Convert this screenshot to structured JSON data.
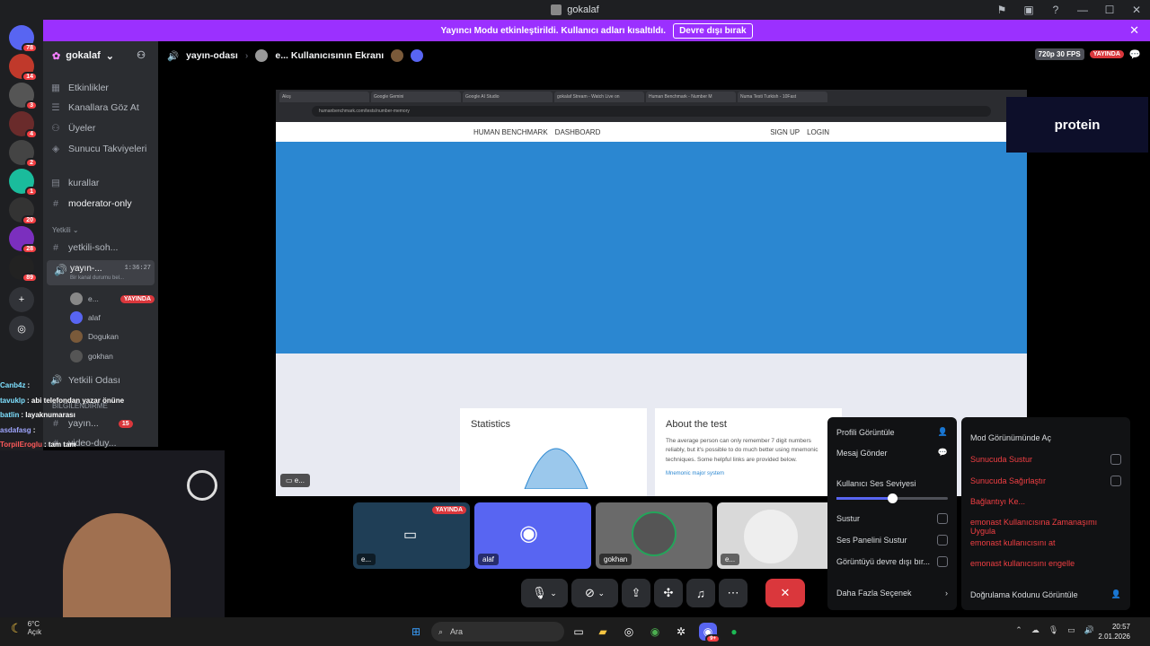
{
  "window": {
    "title": "gokalaf"
  },
  "notice": {
    "text": "Yayıncı Modu etkinleştirildi. Kullanıcı adları kısaltıldı.",
    "button": "Devre dışı bırak"
  },
  "servers": [
    {
      "badge": "78",
      "color": "#5865f2",
      "icon": "discord-icon"
    },
    {
      "badge": "14",
      "color": "#c0392b",
      "icon": "server-icon"
    },
    {
      "badge": "3",
      "color": "#555",
      "icon": "server-icon"
    },
    {
      "badge": "4",
      "color": "#6a2b2b",
      "icon": "server-icon"
    },
    {
      "badge": "2",
      "color": "#444",
      "icon": "eye-icon"
    },
    {
      "badge": "1",
      "color": "#1abc9c",
      "icon": "smile-icon"
    },
    {
      "badge": "20",
      "color": "#333",
      "icon": "server-icon"
    },
    {
      "badge": "28",
      "color": "#7b2fbe",
      "icon": "wifi-icon"
    },
    {
      "badge": "89",
      "color": "#222",
      "icon": "server-icon"
    }
  ],
  "server_header": {
    "name": "gokalaf"
  },
  "nav": [
    {
      "icon": "calendar-icon",
      "label": "Etkinlikler"
    },
    {
      "icon": "browse-icon",
      "label": "Kanallara Göz At"
    },
    {
      "icon": "members-icon",
      "label": "Üyeler"
    },
    {
      "icon": "boost-icon",
      "label": "Sunucu Takviyeleri"
    }
  ],
  "channels": [
    {
      "label": "kurallar"
    },
    {
      "label": "moderator-only"
    }
  ],
  "category": "Yetkili",
  "yetkili_channels": [
    {
      "label": "yetkili-soh..."
    }
  ],
  "voice_channel": {
    "label": "yayın-...",
    "timer": "1:36:27",
    "status": "Bir kanal durumu bel..."
  },
  "voice_users": [
    {
      "name": "e...",
      "live": "YAYINDA"
    },
    {
      "name": "alaf"
    },
    {
      "name": "Dogukan"
    },
    {
      "name": "gokhan"
    }
  ],
  "more_channels": [
    {
      "label": "Yetkili Odası"
    },
    {
      "label": "BILGILENDIRME"
    },
    {
      "label": "yayın...",
      "badge": "15"
    },
    {
      "label": "video-duy..."
    }
  ],
  "voice_header": {
    "channel": "yayın-odası",
    "screen": "e... Kullanıcısının Ekranı",
    "quality": "720p 30 FPS",
    "live": "YAYINDA"
  },
  "browser": {
    "tabs": [
      "Akış",
      "Google Gemini",
      "Google AI Studio",
      "gokalaf Stream - Watch Live on",
      "Human Benchmark - Number M",
      "Numa Testi Turkish - 10Fast"
    ],
    "url": "humanbenchmark.com/tests/number-memory",
    "nav_brand": "HUMAN BENCHMARK",
    "nav_dashboard": "DASHBOARD",
    "nav_signup": "SIGN UP",
    "nav_login": "LOGIN",
    "stats_title": "Statistics",
    "about_title": "About the test",
    "about_text": "The average person can only remember 7 digit numbers reliably, but it's possible to do much better using mnemonic techniques. Some helpful links are provided below.",
    "about_link": "Mnemonic major system",
    "stream_label": "e..."
  },
  "brand_overlay": "protein",
  "chat": [
    {
      "name": "Canb4z",
      "msg": ":",
      "color": "#7ee0ff"
    },
    {
      "name": "tavuklp",
      "msg": ": abi telefondan yazar önüne",
      "color": "#7ee0ff"
    },
    {
      "name": "batlin",
      "msg": ": layaknumarası",
      "color": "#7ee0ff"
    },
    {
      "name": "asdafasg",
      "msg": ":",
      "color": "#9fa6ff"
    },
    {
      "name": "TorpilEroglu",
      "msg": ": tam tam",
      "color": "#ff5a5a"
    }
  ],
  "tiles": [
    {
      "label": "e...",
      "live": "YAYINDA",
      "bg": "#1f3e56"
    },
    {
      "label": "alaf",
      "bg": "#5865f2"
    },
    {
      "label": "gokhan",
      "bg": "#6a6a6a"
    },
    {
      "label": "e...",
      "bg": "#d9d9d9"
    }
  ],
  "menu_left": {
    "view_profile": "Profili Görüntüle",
    "send_message": "Mesaj Gönder",
    "volume_label": "Kullanıcı Ses Seviyesi",
    "volume": 0.5,
    "mute": "Sustur",
    "mute_soundboard": "Ses Panelini Sustur",
    "disable_video": "Görüntüyü devre dışı bır...",
    "more": "Daha Fazla Seçenek"
  },
  "menu_right": {
    "mod_view": "Mod Görünümünde Aç",
    "server_mute": "Sunucuda Sustur",
    "server_deafen": "Sunucuda Sağırlaştır",
    "disconnect": "Bağlantıyı Ke...",
    "timeout": "emonast Kullanıcısına Zamanaşımı Uygula",
    "kick": "emonast kullanıcısını at",
    "ban": "emonast kullanıcısını engelle",
    "verify": "Doğrulama Kodunu Görüntüle"
  },
  "taskbar": {
    "temp": "6°C",
    "weather": "Açık",
    "search": "Ara",
    "time": "20:57",
    "date": "2.01.2026",
    "discord_badge": "9+"
  }
}
